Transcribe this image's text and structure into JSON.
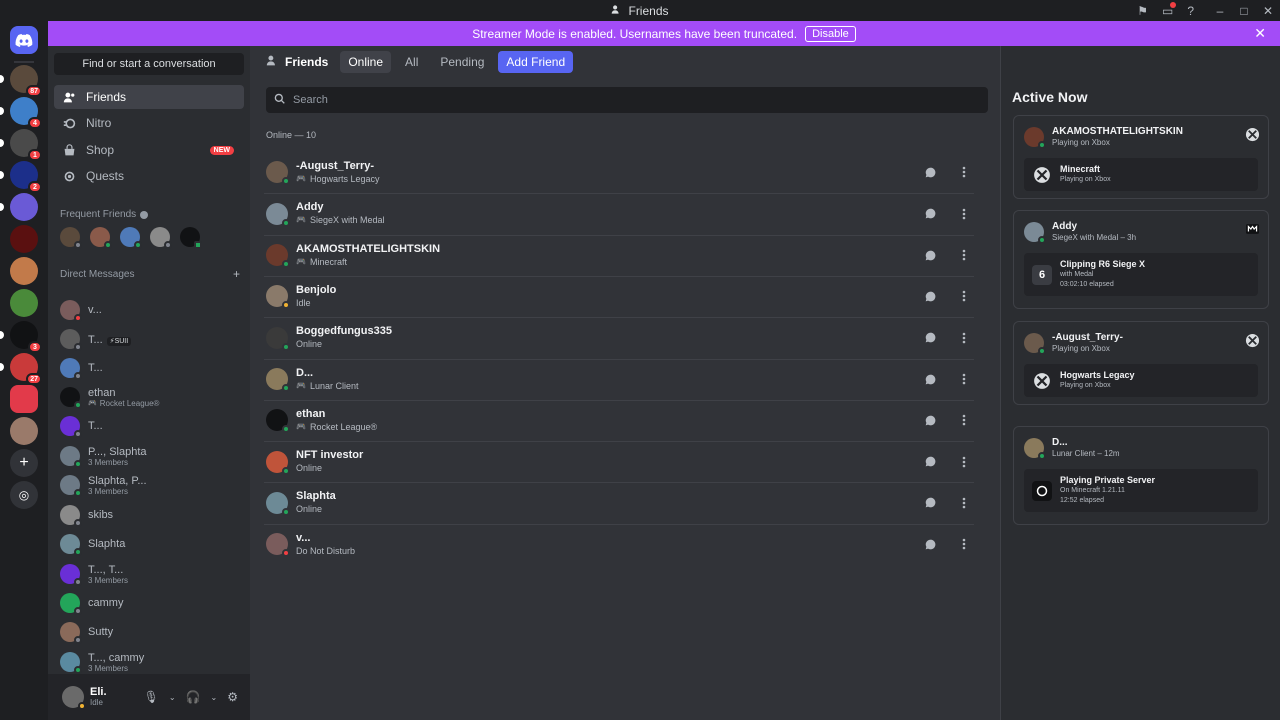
{
  "window": {
    "title": "Friends"
  },
  "banner": {
    "text": "Streamer Mode is enabled. Usernames have been truncated.",
    "button": "Disable"
  },
  "guild_badges": [
    "87",
    "4",
    "1",
    "2",
    "3",
    "27"
  ],
  "sidebar": {
    "search_label": "Find or start a conversation",
    "nav": [
      {
        "label": "Friends",
        "icon": "friends-icon",
        "active": true
      },
      {
        "label": "Nitro",
        "icon": "nitro-icon"
      },
      {
        "label": "Shop",
        "icon": "shop-icon",
        "badge": "NEW"
      },
      {
        "label": "Quests",
        "icon": "quests-icon"
      }
    ],
    "frequent_friends_title": "Frequent Friends",
    "dm_title": "Direct Messages",
    "dms": [
      {
        "name": "v...",
        "sub": "",
        "color": "#7a5c5c",
        "status": "#f23f43"
      },
      {
        "name": "T...",
        "sub": "",
        "tag": "⚡SUII",
        "color": "#5c5c5c",
        "status": "#80848e"
      },
      {
        "name": "T...",
        "sub": "",
        "color": "#4f7ab8",
        "status": "#80848e"
      },
      {
        "name": "ethan",
        "sub": "Rocket League®",
        "color": "#111214",
        "status": "#23a55a",
        "game": true
      },
      {
        "name": "T...",
        "sub": "",
        "color": "#6a2fd6",
        "status": "#80848e"
      },
      {
        "name": "P..., Slaphta",
        "sub": "3 Members",
        "color": "#6d7a86",
        "status": "#23a55a"
      },
      {
        "name": "Slaphta, P...",
        "sub": "3 Members",
        "color": "#6d7a86",
        "status": "#23a55a"
      },
      {
        "name": "skibs",
        "sub": "",
        "color": "#8a8a8a",
        "status": "#80848e"
      },
      {
        "name": "Slaphta",
        "sub": "",
        "color": "#6d8a96",
        "status": "#23a55a"
      },
      {
        "name": "T..., T...",
        "sub": "3 Members",
        "color": "#6a2fd6",
        "status": "#80848e"
      },
      {
        "name": "cammy",
        "sub": "",
        "color": "#23a55a",
        "status": "#80848e"
      },
      {
        "name": "Sutty",
        "sub": "",
        "color": "#8a6a5a",
        "status": "#80848e"
      },
      {
        "name": "T..., cammy",
        "sub": "3 Members",
        "color": "#5a8aa0",
        "status": "#23a55a"
      }
    ],
    "user": {
      "name": "Eli.",
      "status": "Idle"
    }
  },
  "header": {
    "title": "Friends",
    "tabs": [
      "Online",
      "All",
      "Pending"
    ],
    "add_friend": "Add Friend"
  },
  "search": {
    "placeholder": "Search"
  },
  "online_label": "Online — 10",
  "friends": [
    {
      "name": "-August_Terry-",
      "status": "Hogwarts Legacy",
      "game": true,
      "dot": "#23a55a",
      "color": "#6b5a4c"
    },
    {
      "name": "Addy",
      "status": "SiegeX with Medal",
      "game": true,
      "dot": "#23a55a",
      "color": "#7b8a96"
    },
    {
      "name": "AKAMOSTHATELIGHTSKIN",
      "status": "Minecraft",
      "game": true,
      "dot": "#23a55a",
      "color": "#6b3a2c"
    },
    {
      "name": "Benjolo",
      "status": "Idle",
      "dot": "#f0b232",
      "color": "#8a7a6a"
    },
    {
      "name": "Boggedfungus335",
      "status": "Online",
      "dot": "#23a55a",
      "color": "#3a3a3a"
    },
    {
      "name": "D...",
      "status": "Lunar Client",
      "game": true,
      "dot": "#23a55a",
      "color": "#8a7a5c"
    },
    {
      "name": "ethan",
      "status": "Rocket League®",
      "game": true,
      "dot": "#23a55a",
      "color": "#111214"
    },
    {
      "name": "NFT investor",
      "status": "Online",
      "dot": "#23a55a",
      "color": "#c0543a"
    },
    {
      "name": "Slaphta",
      "status": "Online",
      "dot": "#23a55a",
      "color": "#6d8a96"
    },
    {
      "name": "v...",
      "status": "Do Not Disturb",
      "dot": "#f23f43",
      "color": "#7a5c5c"
    }
  ],
  "active_now": {
    "title": "Active Now",
    "cards": [
      {
        "name": "AKAMOSTHATELIGHTSKIN",
        "status": "Playing on Xbox",
        "platform": "xbox-icon",
        "game": "Minecraft",
        "detail1": "Playing on Xbox",
        "detail2": "",
        "color": "#6b3a2c"
      },
      {
        "name": "Addy",
        "status": "SiegeX with Medal – 3h",
        "platform": "medal-icon",
        "game": "Clipping R6 Siege X",
        "detail1": "with Medal",
        "detail2": "03:02:10 elapsed",
        "color": "#7b8a96"
      },
      {
        "name": "-August_Terry-",
        "status": "Playing on Xbox",
        "platform": "xbox-icon",
        "game": "Hogwarts Legacy",
        "detail1": "Playing on Xbox",
        "detail2": "",
        "color": "#6b5a4c"
      },
      {
        "name": "D...",
        "status": "Lunar Client – 12m",
        "platform": "",
        "game": "Playing Private Server",
        "detail1": "On Minecraft 1.21.11",
        "detail2": "12:52 elapsed",
        "color": "#8a7a5c"
      }
    ]
  }
}
